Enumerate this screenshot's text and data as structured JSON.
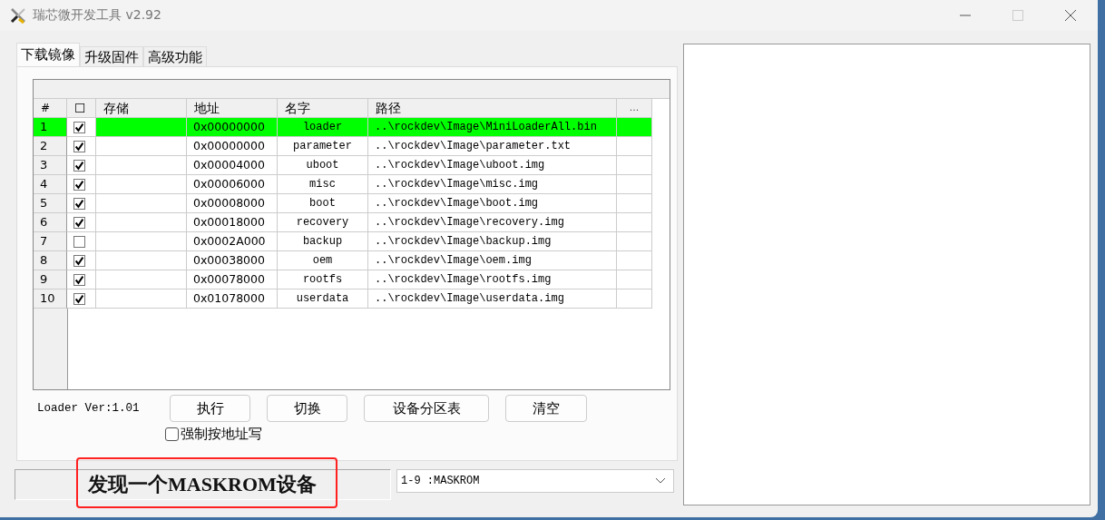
{
  "window": {
    "title": "瑞芯微开发工具 v2.92"
  },
  "tabs": [
    {
      "label": "下载镜像",
      "selected": true
    },
    {
      "label": "升级固件",
      "selected": false
    },
    {
      "label": "高级功能",
      "selected": false
    }
  ],
  "table": {
    "columns": [
      "#",
      "☐",
      "存储",
      "地址",
      "名字",
      "路径",
      "..."
    ],
    "rows": [
      {
        "index": "1",
        "checked": true,
        "selected": true,
        "address": "0x00000000",
        "name": "loader",
        "path": "..\\rockdev\\Image\\MiniLoaderAll.bin"
      },
      {
        "index": "2",
        "checked": true,
        "selected": false,
        "address": "0x00000000",
        "name": "parameter",
        "path": "..\\rockdev\\Image\\parameter.txt"
      },
      {
        "index": "3",
        "checked": true,
        "selected": false,
        "address": "0x00004000",
        "name": "uboot",
        "path": "..\\rockdev\\Image\\uboot.img"
      },
      {
        "index": "4",
        "checked": true,
        "selected": false,
        "address": "0x00006000",
        "name": "misc",
        "path": "..\\rockdev\\Image\\misc.img"
      },
      {
        "index": "5",
        "checked": true,
        "selected": false,
        "address": "0x00008000",
        "name": "boot",
        "path": "..\\rockdev\\Image\\boot.img"
      },
      {
        "index": "6",
        "checked": true,
        "selected": false,
        "address": "0x00018000",
        "name": "recovery",
        "path": "..\\rockdev\\Image\\recovery.img"
      },
      {
        "index": "7",
        "checked": false,
        "selected": false,
        "address": "0x0002A000",
        "name": "backup",
        "path": "..\\rockdev\\Image\\backup.img"
      },
      {
        "index": "8",
        "checked": true,
        "selected": false,
        "address": "0x00038000",
        "name": "oem",
        "path": "..\\rockdev\\Image\\oem.img"
      },
      {
        "index": "9",
        "checked": true,
        "selected": false,
        "address": "0x00078000",
        "name": "rootfs",
        "path": "..\\rockdev\\Image\\rootfs.img"
      },
      {
        "index": "10",
        "checked": true,
        "selected": false,
        "address": "0x01078000",
        "name": "userdata",
        "path": "..\\rockdev\\Image\\userdata.img"
      }
    ]
  },
  "loader_version": "Loader Ver:1.01",
  "buttons": [
    "执行",
    "切换",
    "设备分区表",
    "清空"
  ],
  "force_address_write": {
    "label": "强制按地址写",
    "checked": false
  },
  "status_bar": {
    "message": "发现一个MASKROM设备",
    "device": "1-9 :MASKROM"
  }
}
